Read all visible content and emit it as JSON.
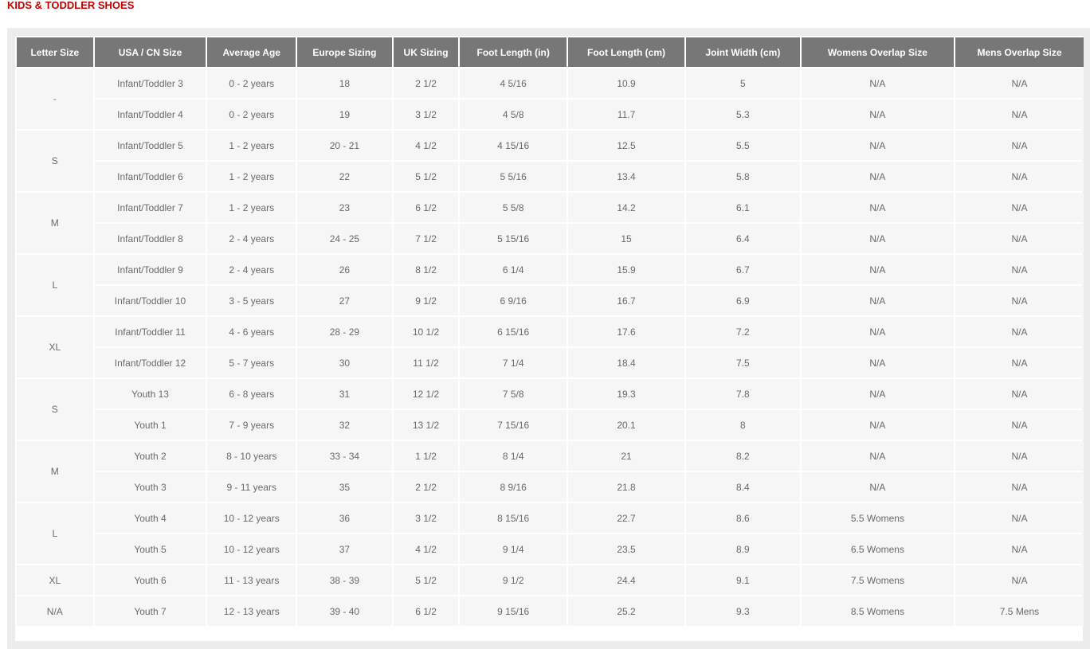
{
  "page": {
    "title": "KIDS & TODDLER SHOES"
  },
  "table": {
    "headers": [
      "Letter Size",
      "USA / CN Size",
      "Average Age",
      "Europe Sizing",
      "UK Sizing",
      "Foot Length (in)",
      "Foot Length (cm)",
      "Joint Width (cm)",
      "Womens Overlap Size",
      "Mens Overlap Size"
    ],
    "groups": [
      {
        "letter": "-",
        "rows": [
          [
            "Infant/Toddler 3",
            "0 - 2 years",
            "18",
            "2 1/2",
            "4 5/16",
            "10.9",
            "5",
            "N/A",
            "N/A"
          ],
          [
            "Infant/Toddler 4",
            "0 - 2 years",
            "19",
            "3 1/2",
            "4 5/8",
            "11.7",
            "5.3",
            "N/A",
            "N/A"
          ]
        ]
      },
      {
        "letter": "S",
        "rows": [
          [
            "Infant/Toddler 5",
            "1 - 2 years",
            "20 - 21",
            "4 1/2",
            "4 15/16",
            "12.5",
            "5.5",
            "N/A",
            "N/A"
          ],
          [
            "Infant/Toddler 6",
            "1 - 2 years",
            "22",
            "5 1/2",
            "5 5/16",
            "13.4",
            "5.8",
            "N/A",
            "N/A"
          ]
        ]
      },
      {
        "letter": "M",
        "rows": [
          [
            "Infant/Toddler 7",
            "1 - 2 years",
            "23",
            "6 1/2",
            "5 5/8",
            "14.2",
            "6.1",
            "N/A",
            "N/A"
          ],
          [
            "Infant/Toddler 8",
            "2 - 4 years",
            "24 - 25",
            "7 1/2",
            "5 15/16",
            "15",
            "6.4",
            "N/A",
            "N/A"
          ]
        ]
      },
      {
        "letter": "L",
        "rows": [
          [
            "Infant/Toddler 9",
            "2 - 4 years",
            "26",
            "8 1/2",
            "6 1/4",
            "15.9",
            "6.7",
            "N/A",
            "N/A"
          ],
          [
            "Infant/Toddler 10",
            "3 - 5 years",
            "27",
            "9 1/2",
            "6 9/16",
            "16.7",
            "6.9",
            "N/A",
            "N/A"
          ]
        ]
      },
      {
        "letter": "XL",
        "rows": [
          [
            "Infant/Toddler 11",
            "4 - 6 years",
            "28 - 29",
            "10 1/2",
            "6 15/16",
            "17.6",
            "7.2",
            "N/A",
            "N/A"
          ],
          [
            "Infant/Toddler 12",
            "5 - 7 years",
            "30",
            "11 1/2",
            "7 1/4",
            "18.4",
            "7.5",
            "N/A",
            "N/A"
          ]
        ]
      },
      {
        "letter": "S",
        "rows": [
          [
            "Youth 13",
            "6 - 8 years",
            "31",
            "12 1/2",
            "7 5/8",
            "19.3",
            "7.8",
            "N/A",
            "N/A"
          ],
          [
            "Youth 1",
            "7 - 9 years",
            "32",
            "13 1/2",
            "7 15/16",
            "20.1",
            "8",
            "N/A",
            "N/A"
          ]
        ]
      },
      {
        "letter": "M",
        "rows": [
          [
            "Youth 2",
            "8 - 10 years",
            "33 - 34",
            "1 1/2",
            "8 1/4",
            "21",
            "8.2",
            "N/A",
            "N/A"
          ],
          [
            "Youth 3",
            "9 - 11 years",
            "35",
            "2 1/2",
            "8 9/16",
            "21.8",
            "8.4",
            "N/A",
            "N/A"
          ]
        ]
      },
      {
        "letter": "L",
        "rows": [
          [
            "Youth 4",
            "10 - 12 years",
            "36",
            "3 1/2",
            "8 15/16",
            "22.7",
            "8.6",
            "5.5 Womens",
            "N/A"
          ],
          [
            "Youth 5",
            "10 - 12 years",
            "37",
            "4 1/2",
            "9 1/4",
            "23.5",
            "8.9",
            "6.5 Womens",
            "N/A"
          ]
        ]
      },
      {
        "letter": "XL",
        "rows": [
          [
            "Youth 6",
            "11 - 13 years",
            "38 - 39",
            "5 1/2",
            "9 1/2",
            "24.4",
            "9.1",
            "7.5 Womens",
            "N/A"
          ]
        ]
      },
      {
        "letter": "N/A",
        "rows": [
          [
            "Youth 7",
            "12 - 13 years",
            "39 - 40",
            "6 1/2",
            "9 15/16",
            "25.2",
            "9.3",
            "8.5 Womens",
            "7.5 Mens"
          ]
        ]
      }
    ]
  },
  "colors": {
    "title": "#c00000",
    "header_bg": "#777777",
    "header_text": "#ffffff",
    "cell_bg": "#f6f6f6",
    "cell_text": "#6a6a6a",
    "frame_bg": "#ececec"
  }
}
